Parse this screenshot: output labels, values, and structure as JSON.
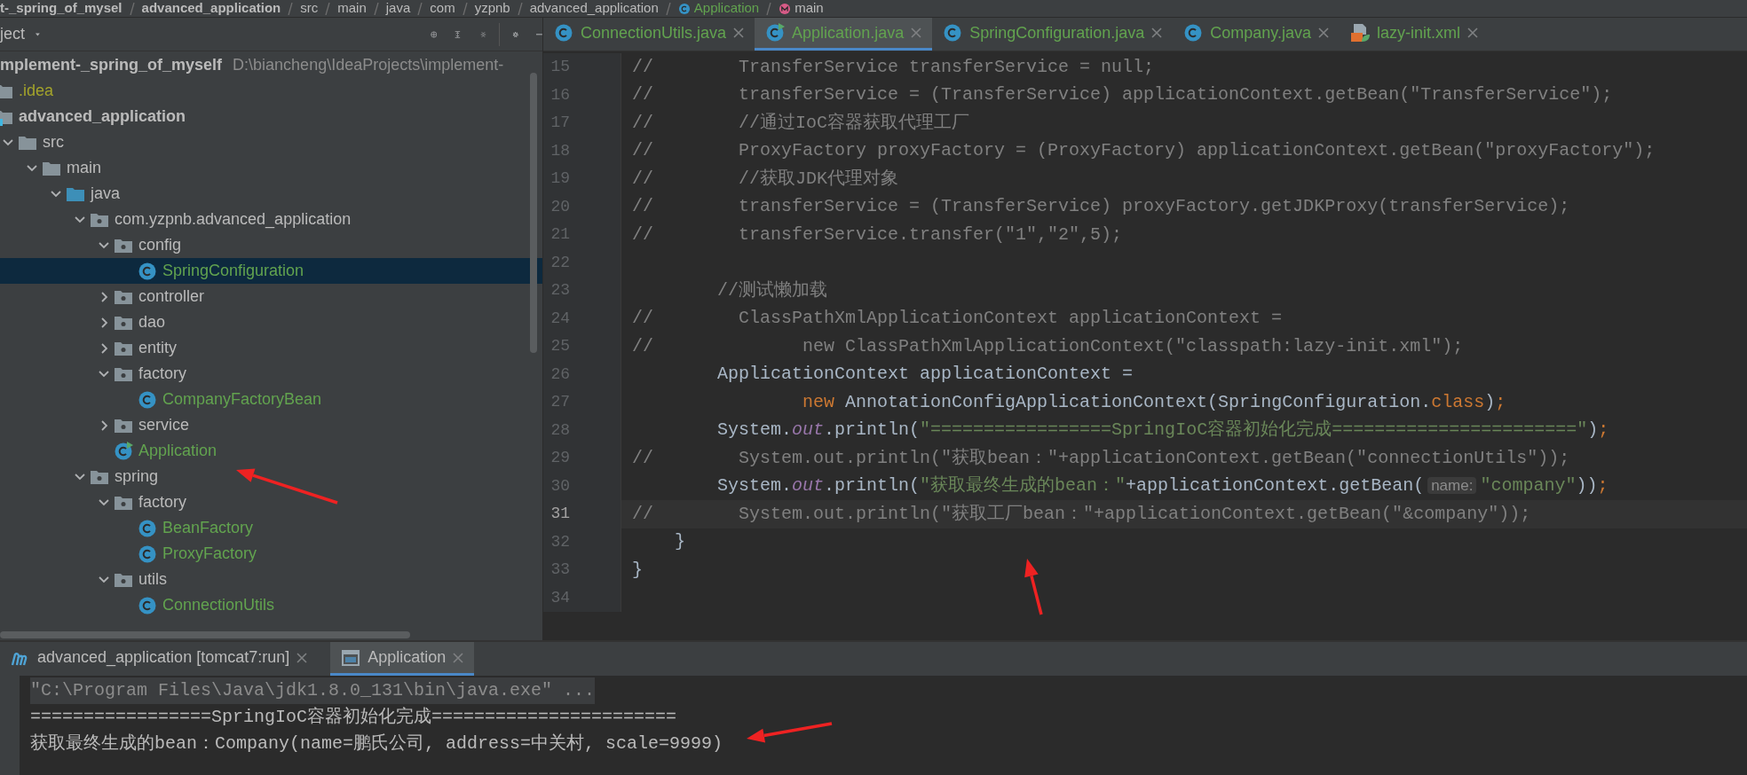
{
  "breadcrumbs": [
    {
      "label": "t-_spring_of_mysel",
      "kind": "module"
    },
    {
      "label": "advanced_application",
      "kind": "module"
    },
    {
      "label": "src",
      "kind": "folder"
    },
    {
      "label": "main",
      "kind": "folder"
    },
    {
      "label": "java",
      "kind": "folder"
    },
    {
      "label": "com",
      "kind": "folder"
    },
    {
      "label": "yzpnb",
      "kind": "folder"
    },
    {
      "label": "advanced_application",
      "kind": "folder"
    },
    {
      "label": "Application",
      "kind": "class"
    },
    {
      "label": "main",
      "kind": "method"
    }
  ],
  "project_panel": {
    "title": "ject",
    "tree": [
      {
        "label": "mplement-_spring_of_myself",
        "path": "D:\\biancheng\\IdeaProjects\\implement-",
        "kind": "root",
        "selected": false,
        "children": [
          {
            "label": ".idea",
            "kind": "folder",
            "color": "#a3a32b",
            "selected": false
          },
          {
            "label": "advanced_application",
            "kind": "module",
            "selected": false,
            "children": [
              {
                "label": "src",
                "kind": "folder",
                "expanded": true,
                "selected": false,
                "children": [
                  {
                    "label": "main",
                    "kind": "folder",
                    "expanded": true,
                    "selected": false,
                    "children": [
                      {
                        "label": "java",
                        "kind": "source",
                        "expanded": true,
                        "selected": false,
                        "children": [
                          {
                            "label": "com.yzpnb.advanced_application",
                            "kind": "package",
                            "expanded": true,
                            "selected": false,
                            "children": [
                              {
                                "label": "config",
                                "kind": "package",
                                "expanded": true,
                                "selected": false,
                                "children": [
                                  {
                                    "label": "SpringConfiguration",
                                    "kind": "class",
                                    "selected": true
                                  }
                                ]
                              },
                              {
                                "label": "controller",
                                "kind": "package",
                                "expanded": false,
                                "selected": false
                              },
                              {
                                "label": "dao",
                                "kind": "package",
                                "expanded": false,
                                "selected": false
                              },
                              {
                                "label": "entity",
                                "kind": "package",
                                "expanded": false,
                                "selected": false
                              },
                              {
                                "label": "factory",
                                "kind": "package",
                                "expanded": true,
                                "selected": false,
                                "children": [
                                  {
                                    "label": "CompanyFactoryBean",
                                    "kind": "class",
                                    "color": "#62a34f",
                                    "selected": false
                                  }
                                ]
                              },
                              {
                                "label": "service",
                                "kind": "package",
                                "expanded": false,
                                "selected": false
                              },
                              {
                                "label": "Application",
                                "kind": "main-class",
                                "color": "#62a34f",
                                "selected": false
                              }
                            ]
                          },
                          {
                            "label": "spring",
                            "kind": "package",
                            "expanded": true,
                            "selected": false,
                            "children": [
                              {
                                "label": "factory",
                                "kind": "package",
                                "expanded": true,
                                "selected": false,
                                "children": [
                                  {
                                    "label": "BeanFactory",
                                    "kind": "class",
                                    "color": "#62a34f",
                                    "selected": false
                                  },
                                  {
                                    "label": "ProxyFactory",
                                    "kind": "class",
                                    "color": "#62a34f",
                                    "selected": false
                                  }
                                ]
                              },
                              {
                                "label": "utils",
                                "kind": "package",
                                "expanded": true,
                                "selected": false,
                                "children": [
                                  {
                                    "label": "ConnectionUtils",
                                    "kind": "class",
                                    "color": "#62a34f",
                                    "selected": false
                                  }
                                ]
                              }
                            ]
                          }
                        ]
                      }
                    ]
                  }
                ]
              }
            ]
          }
        ]
      }
    ]
  },
  "editor_tabs": [
    {
      "label": "ConnectionUtils.java",
      "kind": "class",
      "selected": false
    },
    {
      "label": "Application.java",
      "kind": "main-class",
      "selected": true
    },
    {
      "label": "SpringConfiguration.java",
      "kind": "class",
      "selected": false
    },
    {
      "label": "Company.java",
      "kind": "class",
      "selected": false
    },
    {
      "label": "lazy-init.xml",
      "kind": "xml",
      "selected": false
    }
  ],
  "editor": {
    "lines": [
      {
        "number": "15",
        "current": false,
        "tokens": [
          {
            "text": "//        TransferService transferService = null;",
            "kind": "comment"
          }
        ]
      },
      {
        "number": "16",
        "current": false,
        "tokens": [
          {
            "text": "//        transferService = (TransferService) applicationContext.getBean(\"TransferService\");",
            "kind": "comment"
          }
        ]
      },
      {
        "number": "17",
        "current": false,
        "tokens": [
          {
            "text": "//        //通过IoC容器获取代理工厂",
            "kind": "comment"
          }
        ]
      },
      {
        "number": "18",
        "current": false,
        "tokens": [
          {
            "text": "//        ProxyFactory proxyFactory = (ProxyFactory) applicationContext.getBean(\"proxyFactory\");",
            "kind": "comment"
          }
        ]
      },
      {
        "number": "19",
        "current": false,
        "tokens": [
          {
            "text": "//        //获取JDK代理对象",
            "kind": "comment"
          }
        ]
      },
      {
        "number": "20",
        "current": false,
        "tokens": [
          {
            "text": "//        transferService = (TransferService) proxyFactory.getJDKProxy(transferService);",
            "kind": "comment"
          }
        ]
      },
      {
        "number": "21",
        "current": false,
        "tokens": [
          {
            "text": "//        transferService.transfer(\"1\",\"2\",5);",
            "kind": "comment"
          }
        ]
      },
      {
        "number": "22",
        "current": false
      },
      {
        "number": "23",
        "current": false,
        "tokens": [
          {
            "text": "        //测试懒加载",
            "kind": "comment"
          }
        ]
      },
      {
        "number": "24",
        "current": false,
        "tokens": [
          {
            "text": "//        ClassPathXmlApplicationContext applicationContext =",
            "kind": "comment"
          }
        ]
      },
      {
        "number": "25",
        "current": false,
        "tokens": [
          {
            "text": "//              new ClassPathXmlApplicationContext(\"classpath:lazy-init.xml\");",
            "kind": "comment"
          }
        ]
      },
      {
        "number": "26",
        "current": false,
        "tokens": [
          {
            "text": "        ApplicationContext applicationContext =",
            "kind": "plain"
          }
        ]
      },
      {
        "number": "27",
        "current": false,
        "tokens": [
          {
            "text": "                new",
            "kind": "keyword"
          },
          {
            "text": " AnnotationConfigApplicationContext(SpringConfiguration.",
            "kind": "plain"
          },
          {
            "text": "class",
            "kind": "keyword"
          },
          {
            "text": ")",
            "kind": "plain"
          },
          {
            "text": ";",
            "kind": "keyword"
          }
        ]
      },
      {
        "number": "28",
        "current": false,
        "tokens": [
          {
            "text": "        System.",
            "kind": "plain"
          },
          {
            "text": "out",
            "kind": "field"
          },
          {
            "text": ".println(",
            "kind": "plain"
          },
          {
            "text": "\"=================SpringIoC容器初始化完成=======================\"",
            "kind": "string"
          },
          {
            "text": ")",
            "kind": "plain"
          },
          {
            "text": ";",
            "kind": "keyword"
          }
        ]
      },
      {
        "number": "29",
        "current": false,
        "tokens": [
          {
            "text": "//        System.out.println(\"获取bean：\"+applicationContext.getBean(\"connectionUtils\"));",
            "kind": "comment"
          }
        ]
      },
      {
        "number": "30",
        "current": false,
        "tokens": [
          {
            "text": "        System.",
            "kind": "plain"
          },
          {
            "text": "out",
            "kind": "field"
          },
          {
            "text": ".println(",
            "kind": "plain"
          },
          {
            "text": "\"获取最终生成的bean：\"",
            "kind": "string"
          },
          {
            "text": "+applicationContext.getBean(",
            "kind": "plain"
          },
          {
            "text": "name:",
            "kind": "hint"
          },
          {
            "text": "\"company\"",
            "kind": "string"
          },
          {
            "text": "))",
            "kind": "plain"
          },
          {
            "text": ";",
            "kind": "keyword"
          }
        ]
      },
      {
        "number": "31",
        "current": true,
        "tokens": [
          {
            "text": "//        System.out.println(\"获取工厂bean：\"+applicationContext.getBean(\"&company\"));",
            "kind": "comment"
          }
        ]
      },
      {
        "number": "32",
        "current": false,
        "tokens": [
          {
            "text": "    }",
            "kind": "plain"
          }
        ]
      },
      {
        "number": "33",
        "current": false,
        "tokens": [
          {
            "text": "}",
            "kind": "plain"
          }
        ]
      },
      {
        "number": "34",
        "current": false
      }
    ]
  },
  "run_tabs": [
    {
      "label": "advanced_application [tomcat7:run]",
      "kind": "maven",
      "selected": false
    },
    {
      "label": "Application",
      "kind": "app",
      "selected": true
    }
  ],
  "console": {
    "lines": [
      {
        "text": "\"C:\\Program Files\\Java\\jdk1.8.0_131\\bin\\java.exe\" ...",
        "kind": "command"
      },
      {
        "text": "=================SpringIoC容器初始化完成=======================",
        "kind": "output"
      },
      {
        "text": "获取最终生成的bean：Company(name=鹏氏公司, address=中关村, scale=9999)",
        "kind": "output"
      }
    ]
  }
}
